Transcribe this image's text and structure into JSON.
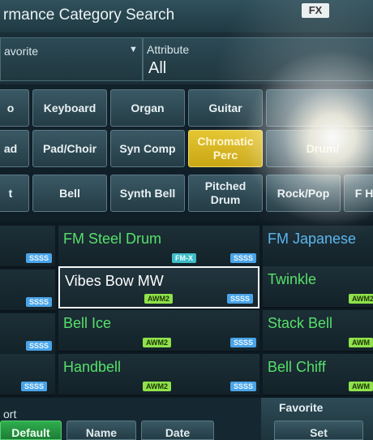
{
  "header": {
    "title": "rmance Category Search",
    "fx_badge": "FX"
  },
  "filters": {
    "favorite_label": "avorite",
    "attribute_label": "Attribute",
    "attribute_value": "All"
  },
  "category_row": [
    {
      "label": "o"
    },
    {
      "label": "Keyboard"
    },
    {
      "label": "Organ"
    },
    {
      "label": "Guitar"
    },
    {
      "label": ""
    }
  ],
  "subcategory_row": [
    {
      "label": "ad"
    },
    {
      "label": "Pad/Choir"
    },
    {
      "label": "Syn Comp"
    },
    {
      "label": "Chromatic Perc",
      "selected": true
    },
    {
      "label": "Drum/"
    }
  ],
  "subsub_row": [
    {
      "label": "t"
    },
    {
      "label": "Bell"
    },
    {
      "label": "Synth Bell"
    },
    {
      "label": "Pitched Drum"
    },
    {
      "label": "Rock/Pop"
    },
    {
      "label": "F Hi"
    }
  ],
  "results": [
    {
      "name": "FM Steel Drum",
      "badge": "SSSS",
      "badge2": "FM-X"
    },
    {
      "name": "FM Japanese",
      "badge": ""
    },
    {
      "name": "Vibes Bow MW",
      "badge": "SSSS",
      "badge2": "AWM2",
      "selected": true
    },
    {
      "name": "Twinkle",
      "badge": "AWM2"
    },
    {
      "name": "Bell Ice",
      "badge": "AWM2",
      "badge2": "SSSS"
    },
    {
      "name": "Stack Bell",
      "badge": "AWM"
    },
    {
      "name": "Handbell",
      "badge": "AWM2",
      "badge2": "SSSS"
    },
    {
      "name": "Bell Chiff",
      "badge": "AWM"
    }
  ],
  "left_badges": [
    "SSSS",
    "SSSS",
    "SSSS",
    "SSSS"
  ],
  "bottom": {
    "sort_label": "ort",
    "sort_buttons": [
      "Default",
      "Name",
      "Date"
    ],
    "favorite_label": "Favorite",
    "favorite_button": "Set"
  },
  "colors": {
    "selected": "#e5c631",
    "name_green": "#56e06a",
    "name_blue": "#5bb6f0"
  }
}
